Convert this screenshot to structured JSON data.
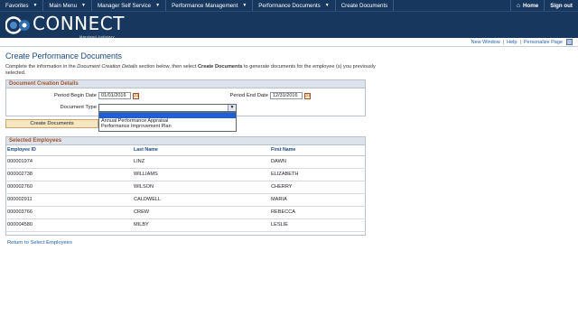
{
  "nav": {
    "items": [
      "Favorites",
      "Main Menu",
      "Manager Self Service",
      "Performance Management",
      "Performance Documents",
      "Create Documents"
    ],
    "home_label": "Home",
    "signout_label": "Sign out"
  },
  "banner": {
    "logo_text": "CONNECT",
    "logo_sub": "Maryland Judiciary"
  },
  "utils": {
    "new_window": "New Window",
    "help": "Help",
    "personalize": "Personalize Page"
  },
  "page": {
    "title": "Create Performance Documents",
    "instruction_1": "Complete the information in the ",
    "instruction_em": "Document Creation Details",
    "instruction_2": " section below, then select ",
    "instruction_strong": "Create Documents",
    "instruction_3": " to generate documents for the employee (s) you previously selected."
  },
  "details": {
    "header": "Document Creation Details",
    "begin_label": "Period Begin Date",
    "begin_value": "01/01/2016",
    "end_label": "Period End Date",
    "end_value": "12/31/2016",
    "doctype_label": "Document Type",
    "doctype_value": "",
    "options": [
      "",
      "Annual Performance Appraisal",
      "Performance Improvement Plan"
    ],
    "cal_glyph": "31"
  },
  "create_button": "Create Documents",
  "employees": {
    "header": "Selected Employees",
    "columns": [
      "Employee ID",
      "Last Name",
      "First Name"
    ],
    "rows": [
      [
        "000001974",
        "LINZ",
        "DAWN"
      ],
      [
        "000002738",
        "WILLIAMS",
        "ELIZABETH"
      ],
      [
        "000002760",
        "WILSON",
        "CHERRY"
      ],
      [
        "000002911",
        "CALDWELL",
        "MARIA"
      ],
      [
        "000003766",
        "CREW",
        "REBECCA"
      ],
      [
        "000004580",
        "MILBY",
        "LESLIE"
      ]
    ]
  },
  "return_link": "Return to Select Employees",
  "colors": {
    "nav_bg": "#17375e",
    "link": "#1f5fa8",
    "section_head": "#a0522d",
    "button_bg": "#f6e6c4"
  }
}
